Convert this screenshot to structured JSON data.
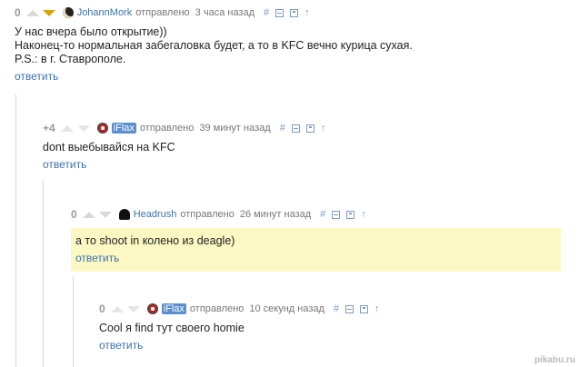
{
  "comments": [
    {
      "rating": "0",
      "author": "JohannMork",
      "sent": "отправлено",
      "time": "3 часа назад",
      "lines": [
        "У нас вчера было открытие))",
        "Наконец-то нормальная забегаловка будет, а то в KFC вечно курица сухая.",
        "P.S.: в г. Ставрополе."
      ],
      "reply": "ответить"
    },
    {
      "rating": "+4",
      "author": "iFlax",
      "sent": "отправлено",
      "time": "39 минут назад",
      "lines": [
        "dont выебывайся на KFC"
      ],
      "reply": "ответить"
    },
    {
      "rating": "0",
      "author": "Headrush",
      "sent": "отправлено",
      "time": "26 минут назад",
      "lines": [
        "а то shoot in колено из deagle)"
      ],
      "reply": "ответить"
    },
    {
      "rating": "0",
      "author": "iFlax",
      "sent": "отправлено",
      "time": "10 секунд назад",
      "lines": [
        "Cool я find тут своего homie"
      ],
      "reply": "ответить"
    }
  ],
  "tools": {
    "hash": "#",
    "up": "↑"
  },
  "watermark": "pikabu.ru",
  "colors": {
    "link": "#3b73af",
    "highlight": "#fbf8c4",
    "active_down": "#d6a400"
  }
}
